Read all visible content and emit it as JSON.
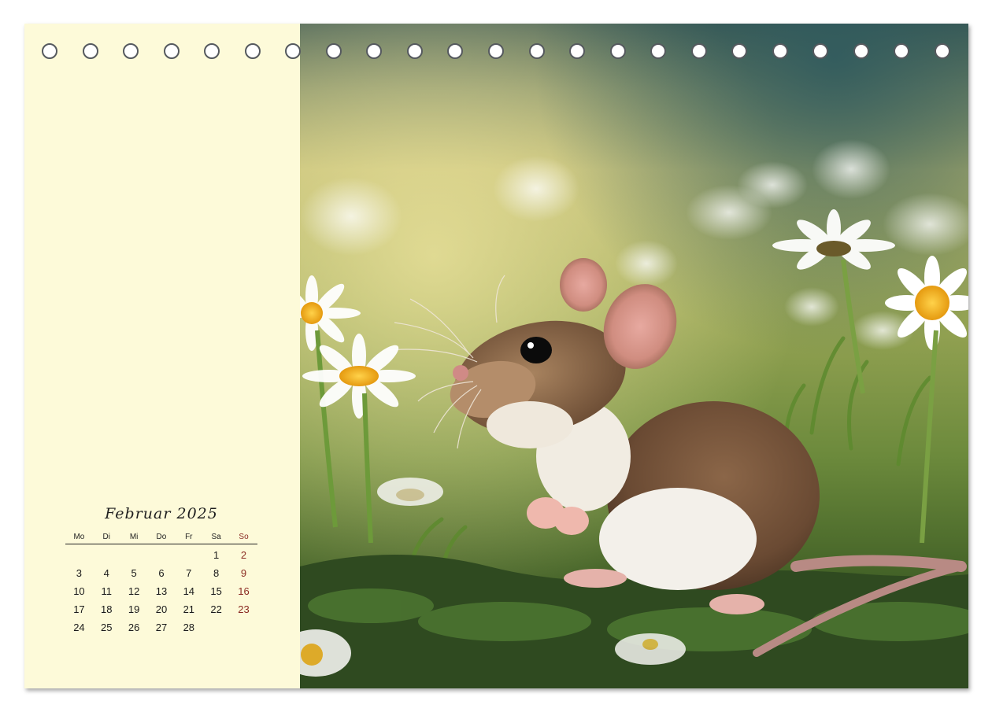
{
  "calendar": {
    "month_title": "Februar 2025",
    "weekdays": [
      "Mo",
      "Di",
      "Mi",
      "Do",
      "Fr",
      "Sa",
      "So"
    ],
    "weeks": [
      [
        "",
        "",
        "",
        "",
        "",
        "1",
        "2"
      ],
      [
        "3",
        "4",
        "5",
        "6",
        "7",
        "8",
        "9"
      ],
      [
        "10",
        "11",
        "12",
        "13",
        "14",
        "15",
        "16"
      ],
      [
        "17",
        "18",
        "19",
        "20",
        "21",
        "22",
        "23"
      ],
      [
        "24",
        "25",
        "26",
        "27",
        "28",
        "",
        ""
      ]
    ]
  },
  "photo": {
    "subject": "mouse-in-daisy-meadow-photo"
  },
  "colors": {
    "panel_background": "#fdfad9",
    "sunday_color": "#8a2a22",
    "hole_ring": "#55595e"
  },
  "binding": {
    "hole_count": 23
  }
}
